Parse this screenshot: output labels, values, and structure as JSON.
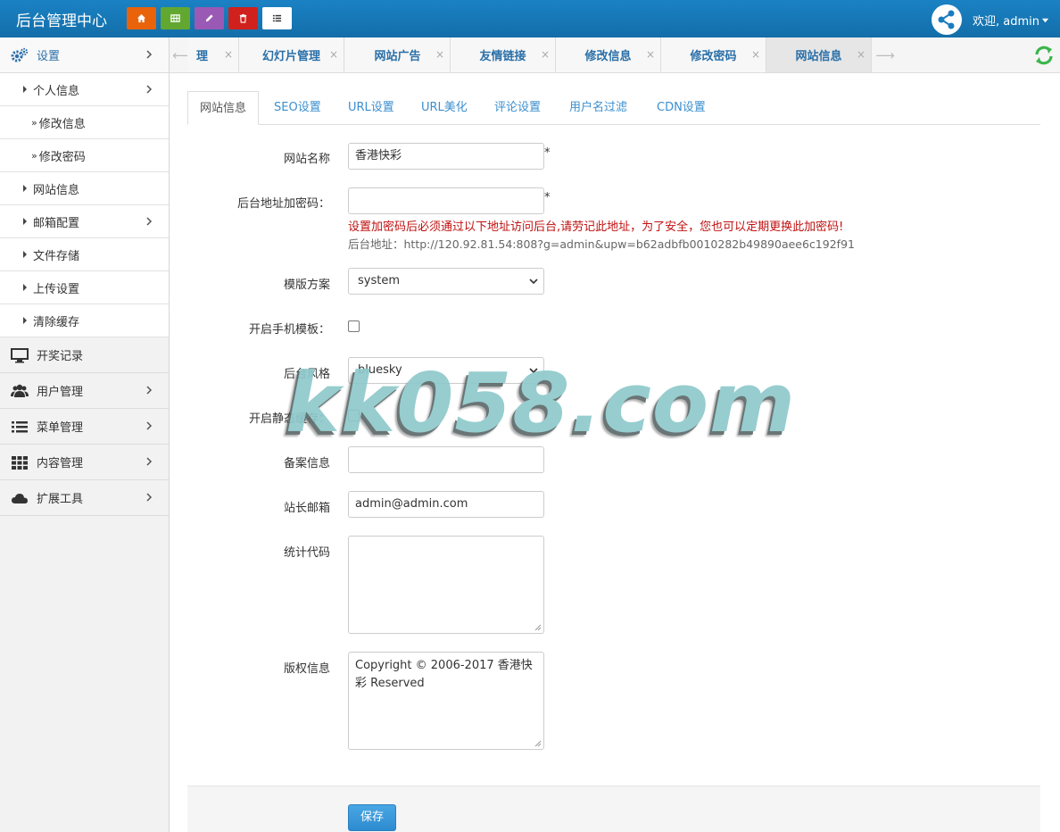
{
  "header": {
    "brand": "后台管理中心",
    "welcome": "欢迎, admin"
  },
  "sidebar": {
    "settings": "设置",
    "profile": "个人信息",
    "edit_info": "修改信息",
    "edit_password": "修改密码",
    "site_info": "网站信息",
    "mail_config": "邮箱配置",
    "file_storage": "文件存储",
    "upload_settings": "上传设置",
    "clear_cache": "清除缓存",
    "lottery_records": "开奖记录",
    "user_mgmt": "用户管理",
    "menu_mgmt": "菜单管理",
    "content_mgmt": "内容管理",
    "ext_tools": "扩展工具",
    "raquo": "»"
  },
  "tabs": [
    "理",
    "幻灯片管理",
    "网站广告",
    "友情链接",
    "修改信息",
    "修改密码",
    "网站信息"
  ],
  "tab_close": "×",
  "subtabs": [
    "网站信息",
    "SEO设置",
    "URL设置",
    "URL美化",
    "评论设置",
    "用户名过滤",
    "CDN设置"
  ],
  "form": {
    "site_name_label": "网站名称",
    "site_name_value": "香港快彩",
    "admin_pwd_label": "后台地址加密码：",
    "admin_pwd_value": "",
    "required_mark": "*",
    "warning": "设置加密码后必须通过以下地址访问后台,请劳记此地址，为了安全，您也可以定期更换此加密码!",
    "admin_url": "后台地址：http://120.92.81.54:808?g=admin&upw=b62adbfb0010282b49890aee6c192f91",
    "template_label": "模版方案",
    "template_value": "system",
    "mobile_tpl_label": "开启手机模板：",
    "admin_style_label": "后台风格",
    "admin_style_value": "bluesky",
    "static_cache_label": "开启静态缓存：",
    "icp_label": "备案信息",
    "icp_value": "",
    "email_label": "站长邮箱",
    "email_value": "admin@admin.com",
    "stats_label": "统计代码",
    "stats_value": "",
    "copyright_label": "版权信息",
    "copyright_value": "Copyright © 2006-2017 香港快彩 Reserved",
    "save": "保存"
  },
  "watermark": "kk058.com"
}
